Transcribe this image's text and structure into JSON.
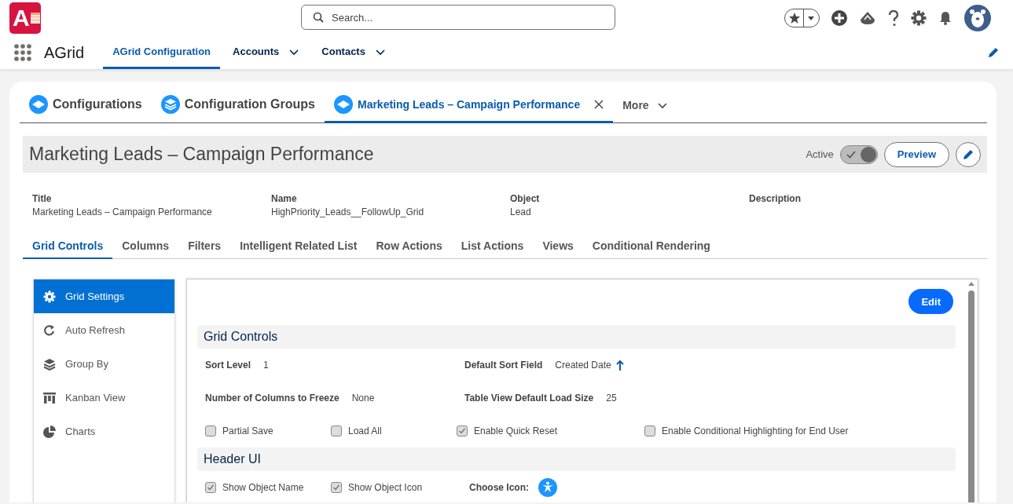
{
  "logo": {
    "letter": "A"
  },
  "search": {
    "placeholder": "Search..."
  },
  "app": {
    "name": "AGrid"
  },
  "nav_tabs": [
    {
      "label": "AGrid Configuration",
      "selected": true,
      "dropdown": false
    },
    {
      "label": "Accounts",
      "selected": false,
      "dropdown": true
    },
    {
      "label": "Contacts",
      "selected": false,
      "dropdown": true
    }
  ],
  "record_tabs": [
    {
      "label": "Configurations",
      "selected": false,
      "closable": false,
      "kind": "config"
    },
    {
      "label": "Configuration Groups",
      "selected": false,
      "closable": false,
      "kind": "group"
    },
    {
      "label": "Marketing Leads – Campaign Performance",
      "selected": true,
      "closable": true,
      "kind": "config"
    }
  ],
  "more": {
    "label": "More"
  },
  "record": {
    "title": "Marketing Leads – Campaign Performance",
    "status_label": "Active",
    "active": true,
    "preview_button": "Preview"
  },
  "fields": [
    {
      "label": "Title",
      "value": "Marketing Leads – Campaign Performance"
    },
    {
      "label": "Name",
      "value": "HighPriority_Leads__FollowUp_Grid"
    },
    {
      "label": "Object",
      "value": "Lead"
    },
    {
      "label": "Description"
    }
  ],
  "sub_tabs": [
    {
      "label": "Grid Controls",
      "selected": true
    },
    {
      "label": "Columns",
      "selected": false
    },
    {
      "label": "Filters",
      "selected": false
    },
    {
      "label": "Intelligent Related List",
      "selected": false
    },
    {
      "label": "Row Actions",
      "selected": false
    },
    {
      "label": "List Actions",
      "selected": false
    },
    {
      "label": "Views",
      "selected": false
    },
    {
      "label": "Conditional Rendering",
      "selected": false
    }
  ],
  "side_menu": [
    {
      "label": "Grid Settings",
      "selected": true,
      "kind": "gear"
    },
    {
      "label": "Auto Refresh",
      "selected": false,
      "kind": "refresh"
    },
    {
      "label": "Group By",
      "selected": false,
      "kind": "layers"
    },
    {
      "label": "Kanban View",
      "selected": false,
      "kind": "kanban"
    },
    {
      "label": "Charts",
      "selected": false,
      "kind": "pie"
    }
  ],
  "panel": {
    "edit_button": "Edit",
    "sections": [
      {
        "title": "Grid Controls",
        "fields": [
          {
            "label": "Sort Level",
            "value": "1"
          },
          {
            "label": "Default Sort Field",
            "value": "Created Date",
            "sort_ascending": true
          },
          {
            "label": "Number of Columns to Freeze",
            "value": "None"
          },
          {
            "label": "Table View Default Load Size",
            "value": "25"
          }
        ],
        "checkboxes": [
          {
            "label": "Partial Save",
            "checked": false
          },
          {
            "label": "Load All",
            "checked": false
          },
          {
            "label": "Enable Quick Reset",
            "checked": true
          },
          {
            "label": "Enable Conditional Highlighting for End User",
            "checked": false
          }
        ]
      },
      {
        "title": "Header UI",
        "checkboxes": [
          {
            "label": "Show Object Name",
            "checked": true
          },
          {
            "label": "Show Object Icon",
            "checked": true
          }
        ],
        "icon_picker": {
          "label": "Choose Icon:"
        }
      }
    ]
  }
}
